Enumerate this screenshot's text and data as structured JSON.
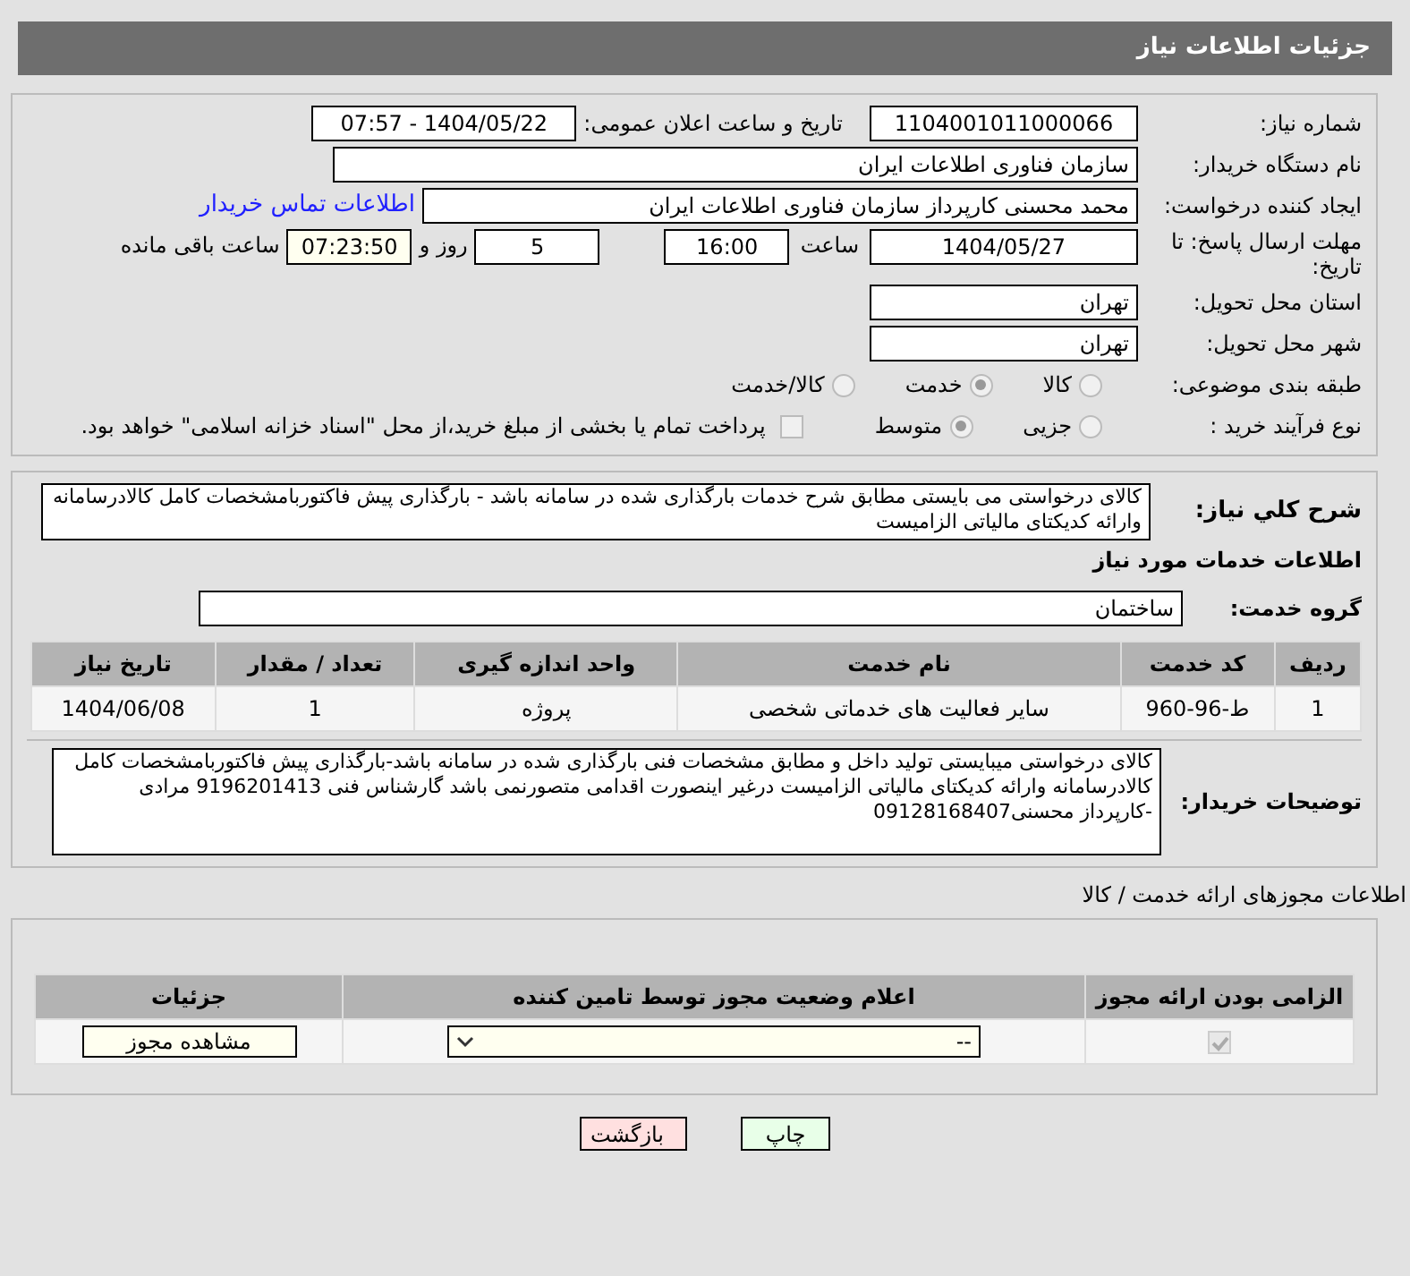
{
  "header": {
    "title": "جزئیات اطلاعات نیاز"
  },
  "form": {
    "need_number": {
      "label": "شماره نیاز:",
      "value": "1104001011000066"
    },
    "announce": {
      "label": "تاریخ و ساعت اعلان عمومی:",
      "value": "1404/05/22 - 07:57"
    },
    "buyer_org": {
      "label": "نام دستگاه خریدار:",
      "value": "سازمان فناوری اطلاعات ایران"
    },
    "requester": {
      "label": "ایجاد کننده درخواست:",
      "value": "محمد محسنی کارپرداز سازمان فناوری اطلاعات ایران",
      "link": "اطلاعات تماس خریدار"
    },
    "deadline": {
      "label": "مهلت ارسال پاسخ: تا تاریخ:",
      "date": "1404/05/27",
      "time_label": "ساعت",
      "time": "16:00",
      "days": "5",
      "days_label": "روز و",
      "remaining": "07:23:50",
      "remaining_label": "ساعت باقی مانده"
    },
    "province": {
      "label": "استان محل تحویل:",
      "value": "تهران"
    },
    "city": {
      "label": "شهر محل تحویل:",
      "value": "تهران"
    },
    "category": {
      "label": "طبقه بندی موضوعی:",
      "options": [
        {
          "label": "کالا",
          "selected": false
        },
        {
          "label": "خدمت",
          "selected": true
        },
        {
          "label": "کالا/خدمت",
          "selected": false
        }
      ]
    },
    "purchase_type": {
      "label": "نوع فرآیند خرید :",
      "options": [
        {
          "label": "جزیی",
          "selected": false
        },
        {
          "label": "متوسط",
          "selected": true
        }
      ],
      "payment": {
        "label": "پرداخت تمام یا بخشی از مبلغ خرید،از محل \"اسناد خزانه اسلامی\" خواهد بود.",
        "checked": false
      }
    }
  },
  "summary": {
    "label": "شرح کلي نیاز:",
    "text": "کالای درخواستی می بایستی مطابق شرح خدمات بارگذاری شده در سامانه باشد - بارگذاری پیش فاکتوربامشخصات کامل کالادرسامانه وارائه کدیکتای مالیاتی الزامیست"
  },
  "services_title": "اطلاعات خدمات مورد نیاز",
  "service_group": {
    "label": "گروه خدمت:",
    "value": "ساختمان"
  },
  "services_table": {
    "columns": [
      "ردیف",
      "کد خدمت",
      "نام خدمت",
      "واحد اندازه گیری",
      "تعداد / مقدار",
      "تاریخ نیاز"
    ],
    "rows": [
      [
        "1",
        "ط-96-960",
        "سایر فعالیت های خدماتی شخصی",
        "پروژه",
        "1",
        "1404/06/08"
      ]
    ]
  },
  "buyer_notes": {
    "label": "توضیحات خریدار:",
    "text": "کالای درخواستی میبایستی تولید داخل و مطابق مشخصات فنی بارگذاری شده در سامانه باشد-بارگذاری پیش فاکتوربامشخصات کامل کالادرسامانه وارائه کدیکتای مالیاتی الزامیست درغیر اینصورت اقدامی متصورنمی باشد گارشناس فنی 9196201413 مرادی -کارپرداز محسنی09128168407"
  },
  "permits_title": "اطلاعات مجوزهای ارائه خدمت / کالا",
  "permits_table": {
    "columns": [
      "الزامی بودن ارائه مجوز",
      "اعلام وضعیت مجوز توسط تامین کننده",
      "جزئیات"
    ],
    "rows": [
      {
        "required": true,
        "status": "--",
        "details": "مشاهده مجوز"
      }
    ]
  },
  "buttons": [
    {
      "label": "چاپ",
      "kind": "print"
    },
    {
      "label": "بازگشت",
      "kind": "back"
    }
  ]
}
